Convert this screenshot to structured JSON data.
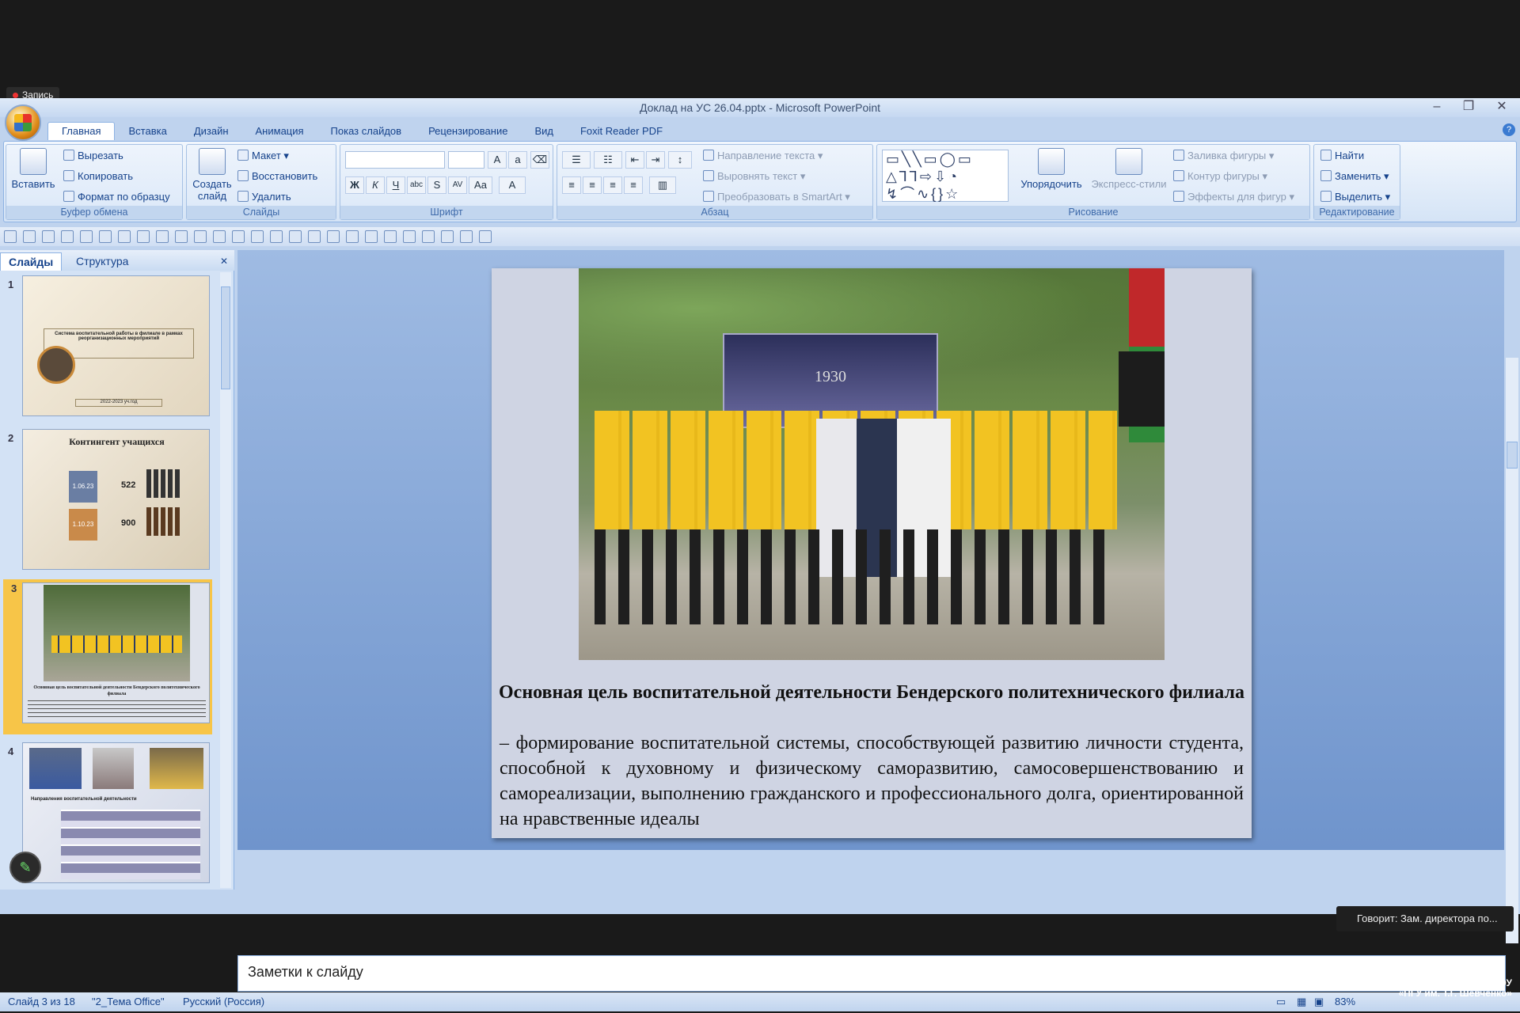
{
  "recording": {
    "label": "Запись"
  },
  "window": {
    "title": "Доклад на УС 26.04.pptx - Microsoft PowerPoint"
  },
  "tabs": [
    "Главная",
    "Вставка",
    "Дизайн",
    "Анимация",
    "Показ слайдов",
    "Рецензирование",
    "Вид",
    "Foxit Reader PDF"
  ],
  "ribbon": {
    "clipboard": {
      "label": "Буфер обмена",
      "paste": "Вставить",
      "cut": "Вырезать",
      "copy": "Копировать",
      "format": "Формат по образцу"
    },
    "slides": {
      "label": "Слайды",
      "new": "Создать слайд",
      "layout": "Макет",
      "reset": "Восстановить",
      "delete": "Удалить"
    },
    "font": {
      "label": "Шрифт"
    },
    "paragraph": {
      "label": "Абзац",
      "direction": "Направление текста",
      "align": "Выровнять текст",
      "smartart": "Преобразовать в SmartArt"
    },
    "drawing": {
      "label": "Рисование",
      "arrange": "Упорядочить",
      "styles": "Экспресс-стили",
      "fill": "Заливка фигуры",
      "outline": "Контур фигуры",
      "effects": "Эффекты для фигур"
    },
    "editing": {
      "label": "Редактирование",
      "find": "Найти",
      "replace": "Заменить",
      "select": "Выделить"
    }
  },
  "panel": {
    "tab_slides": "Слайды",
    "tab_outline": "Структура"
  },
  "thumbs": [
    {
      "num": "1",
      "title": "Система воспитательной работы в филиале в рамках реорганизационных мероприятий",
      "date": "2022-2023 уч.год"
    },
    {
      "num": "2",
      "title": "Контингент учащихся",
      "a_date": "1.06.23",
      "a_val": "522",
      "b_date": "1.10.23",
      "b_val": "900"
    },
    {
      "num": "3",
      "title": "Основная цель воспитательной деятельности Бендерского политехнического филиала"
    },
    {
      "num": "4",
      "title": "Направления воспитательной деятельности"
    }
  ],
  "slide": {
    "banner_year": "1930",
    "title": "Основная цель воспитательной деятельности Бендерского политехнического филиала",
    "body": "– формирование воспитательной системы, способствующей развитию личности студента, способной к духовному и физическому саморазвитию, самосовершенствованию и самореализации, выполнению гражданского и профессионального долга, ориентированной на нравственные идеалы"
  },
  "notes": {
    "placeholder": "Заметки к слайду"
  },
  "status": {
    "slide": "Слайд 3 из 18",
    "theme": "\"2_Тема Office\"",
    "lang": "Русский (Россия)",
    "zoom": "83%"
  },
  "speaking": "Говорит: Зам. директора по...",
  "brand": {
    "line1": "БПФ ГОУ",
    "line2": "«ПГУ им. Т.Г. Шевченко»"
  }
}
